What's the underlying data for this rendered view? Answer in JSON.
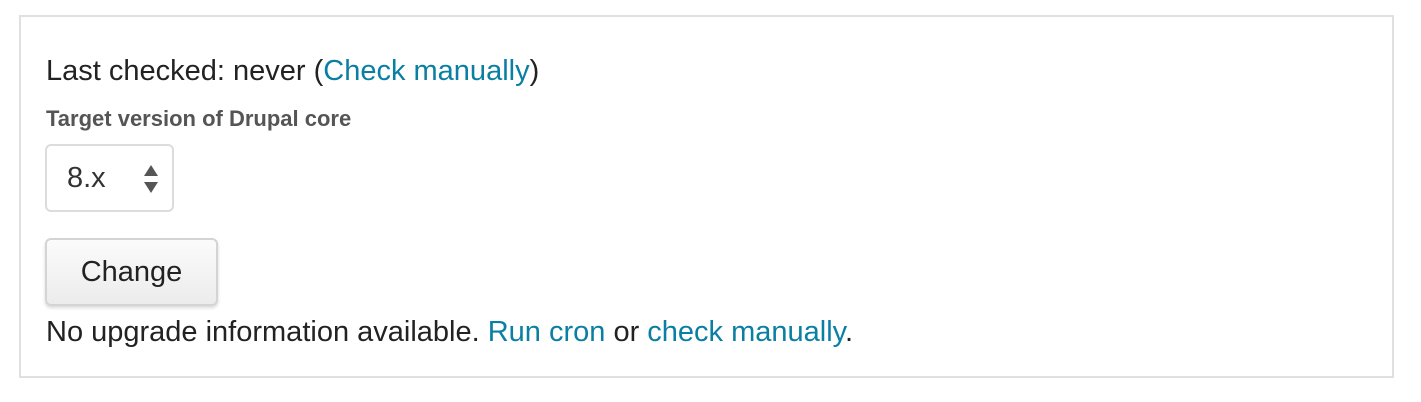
{
  "last_checked": {
    "prefix": "Last checked: never (",
    "link_label": "Check manually",
    "suffix": ")"
  },
  "target_version": {
    "label": "Target version of Drupal core",
    "selected_value": "8.x",
    "arrow_icon": "up-down-arrows-icon"
  },
  "change_button": {
    "label": "Change"
  },
  "status": {
    "text_before": "No upgrade information available. ",
    "run_cron_label": "Run cron",
    "text_middle": " or ",
    "check_manually_label": "check manually",
    "text_after": "."
  },
  "colors": {
    "link": "#0a7fa3",
    "text": "#222222",
    "label": "#555555",
    "border": "#e0e0e0"
  }
}
